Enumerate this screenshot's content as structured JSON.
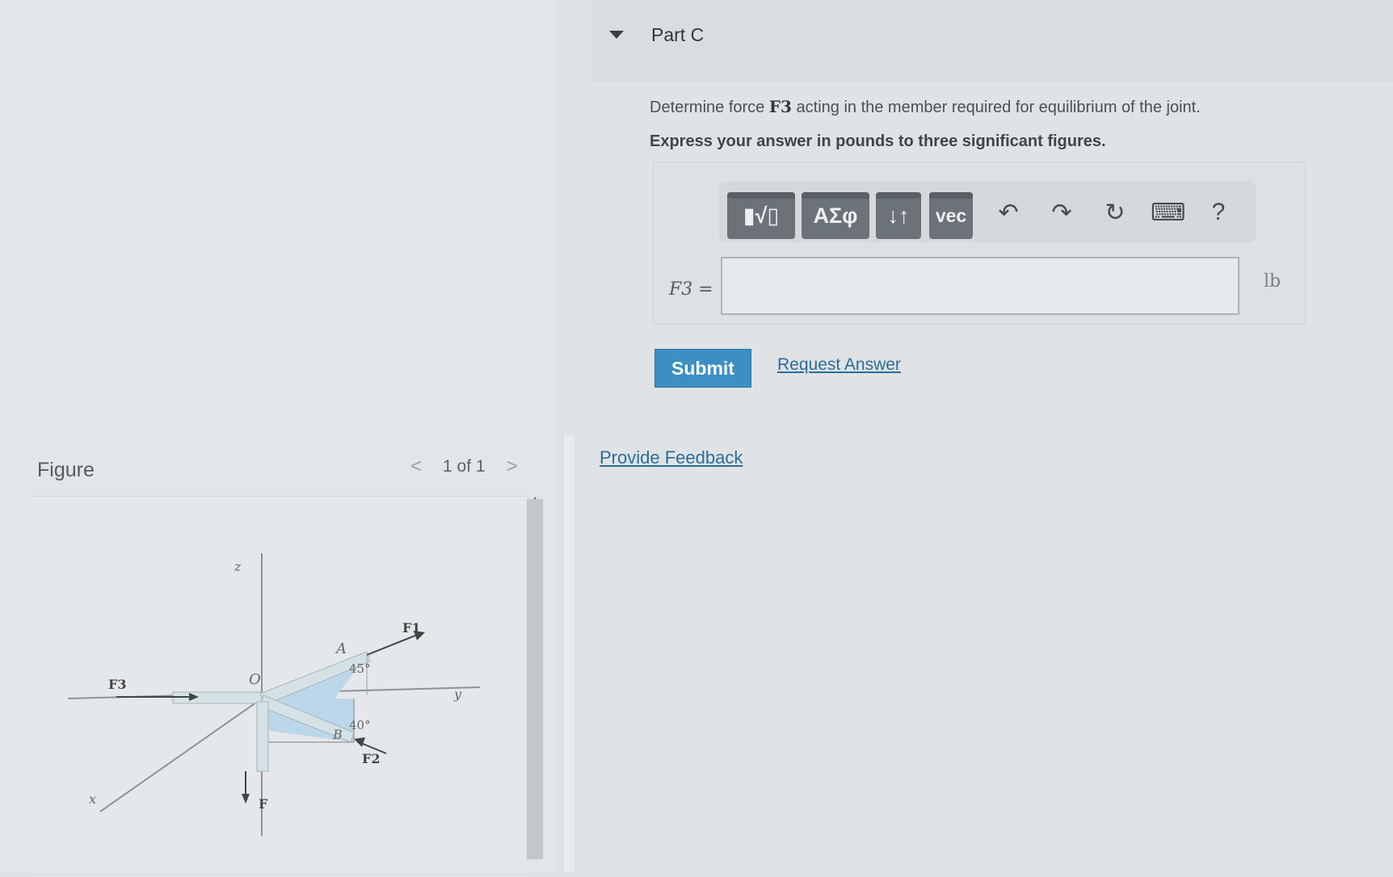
{
  "figure": {
    "label": "Figure",
    "pager": {
      "prev": "<",
      "text": "1 of 1",
      "next": ">"
    },
    "diagram_labels": {
      "axis_z": "z",
      "axis_y": "y",
      "axis_x": "x",
      "origin": "O",
      "point_a": "A",
      "point_b": "B",
      "force_1": "F1",
      "force_2": "F2",
      "force_3": "F3",
      "force_down": "F",
      "angle_a": "45°",
      "angle_b": "40°"
    }
  },
  "part": {
    "title": "Part C"
  },
  "question": {
    "prefix": "Determine force ",
    "symbol": "F3",
    "suffix": " acting in the member required for equilibrium of the joint.",
    "instruction": "Express your answer in pounds to three significant figures."
  },
  "toolbar": {
    "buttons": [
      {
        "icon": "templates-icon",
        "label": "▮√▯"
      },
      {
        "icon": "greek-symbols-icon",
        "label": "ΑΣφ"
      },
      {
        "icon": "sort-icon",
        "label": "↓↑"
      },
      {
        "icon": "vector-icon",
        "label": "vec"
      }
    ],
    "icons": [
      {
        "name": "undo-icon",
        "glyph": "↶"
      },
      {
        "name": "redo-icon",
        "glyph": "↷"
      },
      {
        "name": "reset-icon",
        "glyph": "↻"
      },
      {
        "name": "keyboard-icon",
        "glyph": "⌨"
      },
      {
        "name": "help-icon",
        "glyph": "?"
      }
    ]
  },
  "answer": {
    "label": "F3 =",
    "value": "",
    "placeholder": "",
    "unit": "lb"
  },
  "actions": {
    "submit": "Submit",
    "request_answer": "Request Answer",
    "feedback": "Provide Feedback"
  },
  "colors": {
    "submit_bg": "#3b8fc2",
    "link": "#2c6d9a",
    "toolbar_button": "#6c7378",
    "figure_member_fill": "#bcd7ea"
  }
}
